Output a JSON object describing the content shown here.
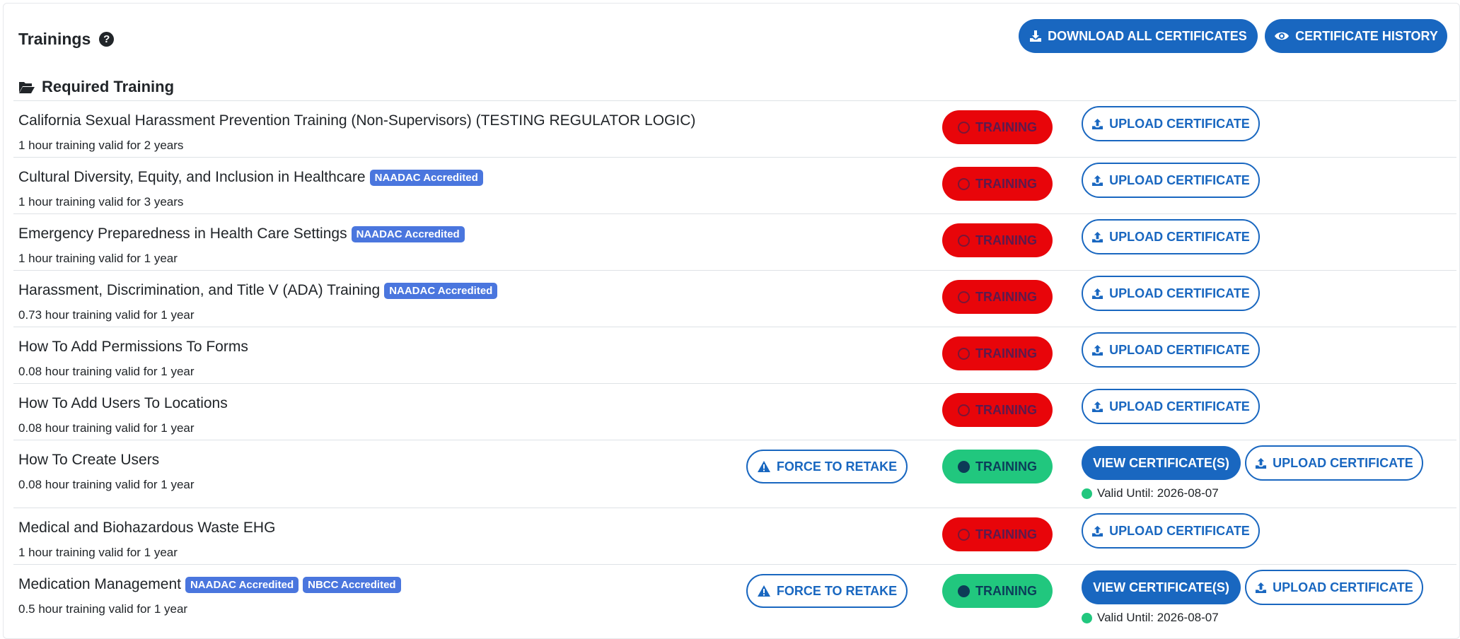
{
  "header": {
    "title": "Trainings",
    "help_icon": "question-circle-icon",
    "download_all_label": "DOWNLOAD ALL CERTIFICATES",
    "certificate_history_label": "CERTIFICATE HISTORY"
  },
  "section": {
    "title": "Required Training",
    "icon": "folder-open-icon"
  },
  "colors": {
    "primary": "#1967c0",
    "status_incomplete": "#e8050a",
    "status_complete": "#21c77e",
    "badge": "#4a76de"
  },
  "labels": {
    "status": "TRAINING",
    "upload": "UPLOAD CERTIFICATE",
    "view": "VIEW CERTIFICATE(S)",
    "force": "FORCE TO RETAKE",
    "valid_prefix": "Valid Until: "
  },
  "trainings": [
    {
      "name": "California Sexual Harassment Prevention Training (Non-Supervisors) (TESTING REGULATOR LOGIC)",
      "badges": [],
      "subtitle": "1 hour training valid for 2 years",
      "status": "incomplete"
    },
    {
      "name": "Cultural Diversity, Equity, and Inclusion in Healthcare",
      "badges": [
        "NAADAC Accredited"
      ],
      "subtitle": "1 hour training valid for 3 years",
      "status": "incomplete"
    },
    {
      "name": "Emergency Preparedness in Health Care Settings",
      "badges": [
        "NAADAC Accredited"
      ],
      "subtitle": "1 hour training valid for 1 year",
      "status": "incomplete"
    },
    {
      "name": "Harassment, Discrimination, and Title V (ADA) Training",
      "badges": [
        "NAADAC Accredited"
      ],
      "subtitle": "0.73 hour training valid for 1 year",
      "status": "incomplete"
    },
    {
      "name": "How To Add Permissions To Forms",
      "badges": [],
      "subtitle": "0.08 hour training valid for 1 year",
      "status": "incomplete"
    },
    {
      "name": "How To Add Users To Locations",
      "badges": [],
      "subtitle": "0.08 hour training valid for 1 year",
      "status": "incomplete"
    },
    {
      "name": "How To Create Users",
      "badges": [],
      "subtitle": "0.08 hour training valid for 1 year",
      "status": "complete",
      "valid_until": "Valid Until: 2026-08-07"
    },
    {
      "name": "Medical and Biohazardous Waste EHG",
      "badges": [],
      "subtitle": "1 hour training valid for 1 year",
      "status": "incomplete"
    },
    {
      "name": "Medication Management",
      "badges": [
        "NAADAC Accredited",
        "NBCC Accredited"
      ],
      "subtitle": "0.5 hour training valid for 1 year",
      "status": "complete",
      "valid_until": "Valid Until: 2026-08-07"
    }
  ]
}
